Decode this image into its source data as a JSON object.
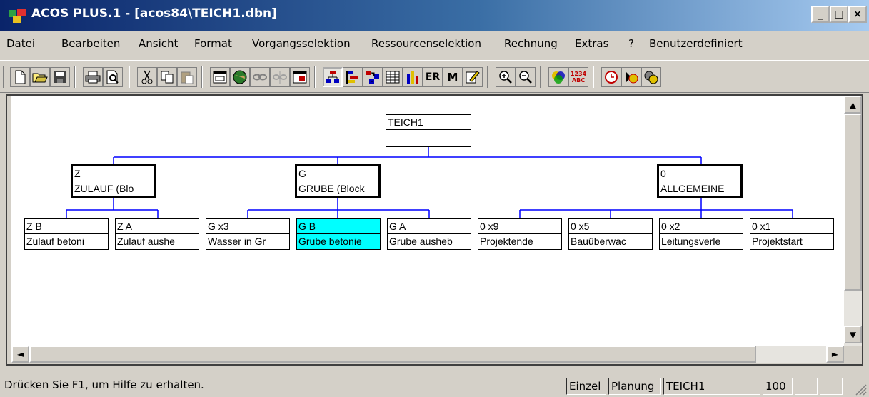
{
  "window": {
    "title": "ACOS PLUS.1 - [acos84\\TEICH1.dbn]",
    "minimize_label": "_",
    "maximize_label": "□",
    "close_label": "×"
  },
  "menu": [
    "Datei",
    "Bearbeiten",
    "Ansicht",
    "Format",
    "Vorgangsselektion",
    "Ressourcenselektion",
    "Rechnung",
    "Extras",
    "?",
    "Benutzerdefiniert"
  ],
  "toolbar": {
    "icons": [
      "new-document-icon",
      "open-folder-icon",
      "save-icon",
      "print-icon",
      "print-preview-icon",
      "cut-icon",
      "copy-icon",
      "paste-icon",
      "properties-icon",
      "globe-icon",
      "link-icon",
      "unlink-icon",
      "calendar-icon",
      "structure-tree-icon",
      "gantt-icon",
      "network-icon",
      "table-icon",
      "histogram-icon",
      "report-icon",
      "m-icon",
      "edit-icon",
      "zoom-in-icon",
      "zoom-out-icon",
      "color-circles-icon",
      "number-abc-icon",
      "clock-icon",
      "timer-start-icon",
      "gear-clock-icon"
    ],
    "m_letter": "M",
    "r_letters": "ER",
    "num_badge_top": "1234",
    "num_badge_bottom": "ABC"
  },
  "tree": {
    "root": {
      "code": "TEICH1",
      "name": ""
    },
    "groups": [
      {
        "code": "Z",
        "name": "ZULAUF (Blo"
      },
      {
        "code": "G",
        "name": "GRUBE (Block"
      },
      {
        "code": "0",
        "name": "ALLGEMEINE"
      }
    ],
    "leaves": [
      {
        "code": "Z B",
        "name": "Zulauf betoni"
      },
      {
        "code": "Z A",
        "name": "Zulauf aushe"
      },
      {
        "code": "G x3",
        "name": "Wasser in Gr"
      },
      {
        "code": "G B",
        "name": "Grube betonie"
      },
      {
        "code": "G A",
        "name": "Grube ausheb"
      },
      {
        "code": "0 x9",
        "name": "Projektende"
      },
      {
        "code": "0 x5",
        "name": "Bauüberwac"
      },
      {
        "code": "0 x2",
        "name": "Leitungsverle"
      },
      {
        "code": "0 x1",
        "name": "Projektstart"
      }
    ],
    "selected_leaf": "G B",
    "colors": {
      "connector": "#0000ff",
      "selected": "#00ffff"
    }
  },
  "scrollbar": {
    "up": "▲",
    "down": "▼",
    "left": "◄",
    "right": "►"
  },
  "status": {
    "message": "Drücken Sie F1, um Hilfe zu erhalten.",
    "mode": "Einzel",
    "phase": "Planung",
    "project": "TEICH1",
    "zoom": "100"
  }
}
